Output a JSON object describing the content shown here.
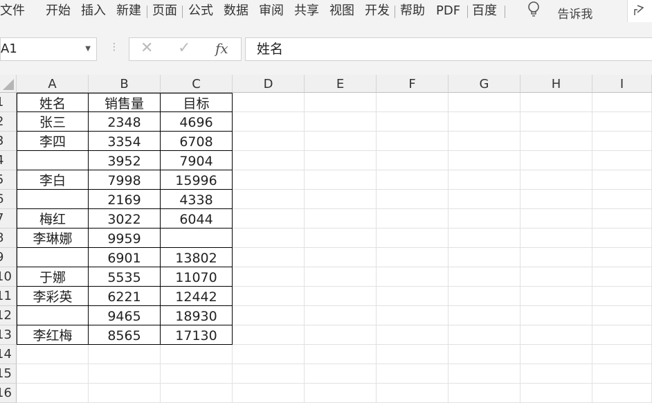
{
  "menu_tabs": [
    "文件",
    "开始",
    "插入",
    "新建",
    "页面",
    "公式",
    "数据",
    "审阅",
    "共享",
    "视图",
    "开发",
    "帮助",
    "PDF",
    "百度"
  ],
  "tell_me": "告诉我",
  "name_box": "A1",
  "formula_value": "姓名",
  "fx_label": "fx",
  "columns": [
    "A",
    "B",
    "C",
    "D",
    "E",
    "F",
    "G",
    "H",
    "I"
  ],
  "rows": [
    "1",
    "2",
    "3",
    "4",
    "5",
    "6",
    "7",
    "8",
    "9",
    "10",
    "11",
    "12",
    "13",
    "14",
    "15",
    "16"
  ],
  "table": [
    [
      "姓名",
      "销售量",
      "目标"
    ],
    [
      "张三",
      "2348",
      "4696"
    ],
    [
      "李四",
      "3354",
      "6708"
    ],
    [
      "",
      "3952",
      "7904"
    ],
    [
      "李白",
      "7998",
      "15996"
    ],
    [
      "",
      "2169",
      "4338"
    ],
    [
      "梅红",
      "3022",
      "6044"
    ],
    [
      "李琳娜",
      "9959",
      ""
    ],
    [
      "",
      "6901",
      "13802"
    ],
    [
      "于娜",
      "5535",
      "11070"
    ],
    [
      "李彩英",
      "6221",
      "12442"
    ],
    [
      "",
      "9465",
      "18930"
    ],
    [
      "李红梅",
      "8565",
      "17130"
    ]
  ]
}
